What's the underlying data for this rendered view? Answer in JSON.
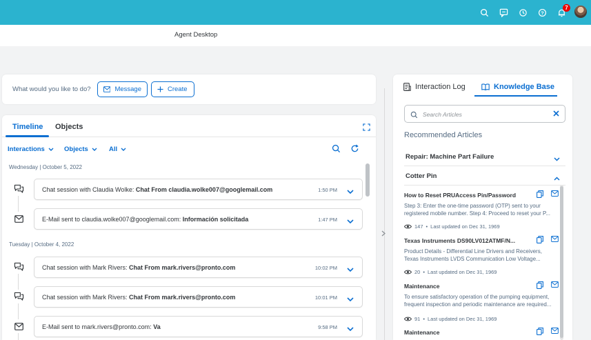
{
  "topbar": {
    "notification_count": "7",
    "icons": [
      "search-icon",
      "feedback-icon",
      "history-icon",
      "help-icon",
      "bell-icon"
    ]
  },
  "app": {
    "title": "Agent Desktop"
  },
  "ask": {
    "prompt": "What would you like to do?",
    "message_label": "Message",
    "create_label": "Create"
  },
  "timeline": {
    "tabs": {
      "timeline": "Timeline",
      "objects": "Objects"
    },
    "filters": {
      "interactions": "Interactions",
      "objects": "Objects",
      "all": "All"
    },
    "groups": [
      {
        "date": "Wednesday | October 5, 2022",
        "entries": [
          {
            "type": "chat",
            "prefix": "Chat session with Claudia Wolke: ",
            "bold": "Chat From claudia.wolke007@googlemail.com",
            "time": "1:50 PM"
          },
          {
            "type": "email",
            "prefix": "E-Mail sent to claudia.wolke007@googlemail.com: ",
            "bold": "Información solicitada",
            "time": "1:47 PM"
          }
        ]
      },
      {
        "date": "Tuesday | October 4, 2022",
        "entries": [
          {
            "type": "chat",
            "prefix": "Chat session with Mark Rivers: ",
            "bold": "Chat From mark.rivers@pronto.com",
            "time": "10:02 PM"
          },
          {
            "type": "chat",
            "prefix": "Chat session with Mark Rivers: ",
            "bold": "Chat From mark.rivers@pronto.com",
            "time": "10:01 PM"
          },
          {
            "type": "email",
            "prefix": "E-Mail sent to mark.rivers@pronto.com: ",
            "bold": "Va",
            "time": "9:58 PM"
          }
        ]
      }
    ]
  },
  "kb": {
    "tabs": {
      "log": "Interaction Log",
      "kb": "Knowledge Base"
    },
    "search_placeholder": "Search Articles",
    "recommended": "Recommended Articles",
    "sections": [
      {
        "label": "Repair: Machine Part Failure",
        "expanded": false
      },
      {
        "label": "Cotter Pin",
        "expanded": true
      }
    ],
    "articles": [
      {
        "title": "How to Reset PRUAccess Pin/Password",
        "lines": [
          "Step 3: Enter the one-time password (OTP) sent to your",
          "registered mobile number. Step 4: Proceed to reset your P..."
        ],
        "views": "147",
        "updated": "Last updated on Dec 31, 1969"
      },
      {
        "title": "Texas Instruments DS90LV012ATMF/N...",
        "lines": [
          "Product Details - Differential Line Drivers and Receivers,",
          "Texas Instruments LVDS Communication Low Voltage..."
        ],
        "views": "20",
        "updated": "Last updated on Dec 31, 1969"
      },
      {
        "title": "Maintenance",
        "lines": [
          "To ensure satisfactory operation of the pumping equipment,",
          "frequent inspection and periodic maintenance are required..."
        ],
        "views": "91",
        "updated": "Last updated on Dec 31, 1969"
      },
      {
        "title": "Maintenance",
        "lines": [],
        "views": "",
        "updated": ""
      }
    ]
  }
}
